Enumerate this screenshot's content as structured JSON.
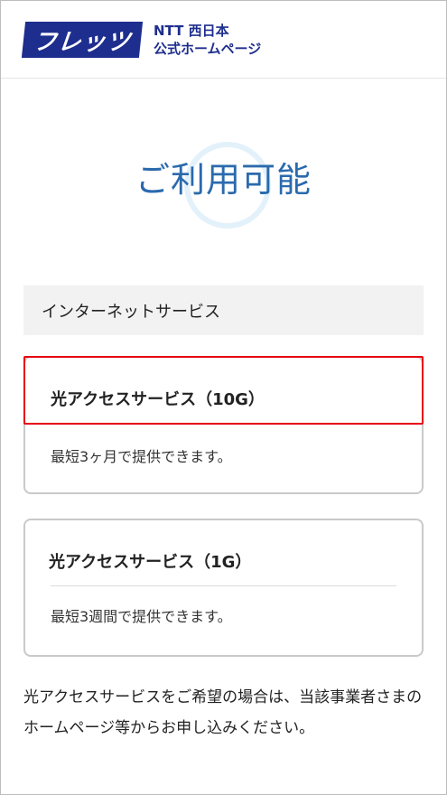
{
  "header": {
    "logo_text": "フレッツ",
    "brand_line1": "NTT 西日本",
    "brand_line2": "公式ホームページ"
  },
  "availability": {
    "status": "ご利用可能"
  },
  "category": {
    "label": "インターネットサービス"
  },
  "services": [
    {
      "name": "光アクセスサービス（10G）",
      "lead_time": "最短3ヶ月で提供できます。"
    },
    {
      "name": "光アクセスサービス（1G）",
      "lead_time": "最短3週間で提供できます。"
    }
  ],
  "note": "光アクセスサービスをご希望の場合は、当該事業者さまのホームページ等からお申し込みください。",
  "colors": {
    "brand_navy": "#1e2e8e",
    "status_blue": "#2a6aad",
    "highlight_red": "#e60012"
  }
}
